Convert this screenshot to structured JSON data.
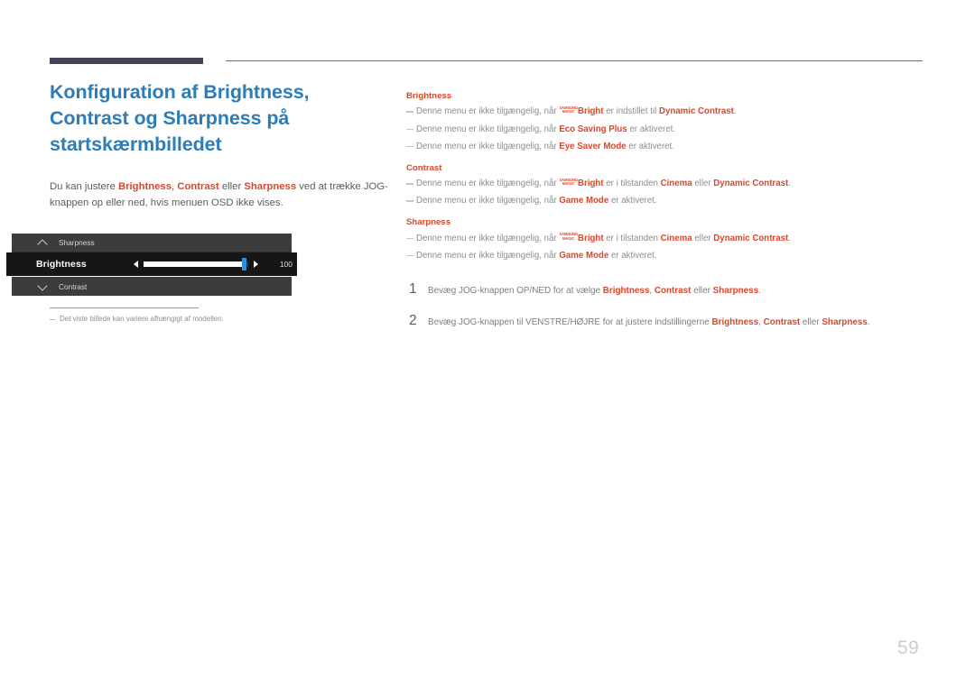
{
  "page": {
    "number": "59",
    "title": "Konfiguration af Brightness, Contrast og Sharpness på startskærmbilledet",
    "intro": {
      "t1": "Du kan justere ",
      "k1": "Brightness",
      "t2": ", ",
      "k2": "Contrast",
      "t3": " eller ",
      "k3": "Sharpness",
      "t4": " ved at trække JOG-knappen op eller ned, hvis menuen OSD ikke vises."
    },
    "figure_note": "Det viste billede kan variere afhængigt af modellen."
  },
  "colors": {
    "title_blue": "#2c7cb5",
    "accent_orange": "#d9472b",
    "body_gray": "#8d8d8f",
    "rule_dark": "#474354",
    "osd_row_bg": "#3c3c3c",
    "osd_selected_bg": "#161616",
    "slider_knob": "#2e8ce0",
    "page_number": "#c9ccd6"
  },
  "osd": {
    "rows": [
      {
        "icon": "chevron-up-icon",
        "label": "Sharpness"
      },
      {
        "icon": "chevron-down-icon",
        "label": "Contrast"
      }
    ],
    "selected": {
      "label": "Brightness",
      "value": "100",
      "left_arrow": "◀",
      "right_arrow": "▶",
      "slider_percent": 96
    }
  },
  "right": {
    "sections": [
      {
        "heading": "Brightness",
        "notes": [
          {
            "parts": [
              {
                "type": "plain",
                "text": "Denne menu er ikke tilgængelig, når "
              },
              {
                "type": "magic"
              },
              {
                "type": "bold",
                "text": "Bright"
              },
              {
                "type": "plain",
                "text": " er indstillet til "
              },
              {
                "type": "bold",
                "text": "Dynamic Contrast"
              },
              {
                "type": "plain",
                "text": "."
              }
            ]
          },
          {
            "parts": [
              {
                "type": "plain",
                "text": "Denne menu er ikke tilgængelig, når "
              },
              {
                "type": "bold",
                "text": "Eco Saving Plus"
              },
              {
                "type": "plain",
                "text": " er aktiveret."
              }
            ]
          },
          {
            "parts": [
              {
                "type": "plain",
                "text": "Denne menu er ikke tilgængelig, når "
              },
              {
                "type": "bold",
                "text": "Eye Saver Mode"
              },
              {
                "type": "plain",
                "text": " er aktiveret."
              }
            ]
          }
        ]
      },
      {
        "heading": "Contrast",
        "notes": [
          {
            "parts": [
              {
                "type": "plain",
                "text": "Denne menu er ikke tilgængelig, når "
              },
              {
                "type": "magic"
              },
              {
                "type": "bold",
                "text": "Bright"
              },
              {
                "type": "plain",
                "text": " er i tilstanden "
              },
              {
                "type": "bold",
                "text": "Cinema"
              },
              {
                "type": "plain",
                "text": " eller "
              },
              {
                "type": "bold",
                "text": "Dynamic Contrast"
              },
              {
                "type": "plain",
                "text": "."
              }
            ]
          },
          {
            "parts": [
              {
                "type": "plain",
                "text": "Denne menu er ikke tilgængelig, når "
              },
              {
                "type": "bold",
                "text": "Game Mode"
              },
              {
                "type": "plain",
                "text": " er aktiveret."
              }
            ]
          }
        ]
      },
      {
        "heading": "Sharpness",
        "notes": [
          {
            "parts": [
              {
                "type": "plain",
                "text": "Denne menu er ikke tilgængelig, når "
              },
              {
                "type": "magic"
              },
              {
                "type": "bold",
                "text": "Bright"
              },
              {
                "type": "plain",
                "text": " er i tilstanden "
              },
              {
                "type": "bold",
                "text": "Cinema"
              },
              {
                "type": "plain",
                "text": " eller "
              },
              {
                "type": "bold",
                "text": "Dynamic Contrast"
              },
              {
                "type": "plain",
                "text": "."
              }
            ]
          },
          {
            "parts": [
              {
                "type": "plain",
                "text": "Denne menu er ikke tilgængelig, når "
              },
              {
                "type": "bold",
                "text": "Game Mode"
              },
              {
                "type": "plain",
                "text": " er aktiveret."
              }
            ]
          }
        ]
      }
    ],
    "magic_logo": {
      "line1": "SAMSUNG",
      "line2": "MAGIC"
    },
    "steps": [
      {
        "num": "1",
        "parts": [
          {
            "type": "plain",
            "text": "Bevæg JOG-knappen OP/NED for at vælge "
          },
          {
            "type": "bold",
            "text": "Brightness"
          },
          {
            "type": "plain",
            "text": ", "
          },
          {
            "type": "bold",
            "text": "Contrast"
          },
          {
            "type": "plain",
            "text": " eller "
          },
          {
            "type": "bold",
            "text": "Sharpness"
          },
          {
            "type": "plain",
            "text": "."
          }
        ]
      },
      {
        "num": "2",
        "parts": [
          {
            "type": "plain",
            "text": "Bevæg JOG-knappen til VENSTRE/HØJRE for at justere indstillingerne "
          },
          {
            "type": "bold",
            "text": "Brightness"
          },
          {
            "type": "plain",
            "text": ", "
          },
          {
            "type": "bold",
            "text": "Contrast"
          },
          {
            "type": "plain",
            "text": " eller "
          },
          {
            "type": "bold",
            "text": "Sharpness"
          },
          {
            "type": "plain",
            "text": "."
          }
        ]
      }
    ]
  }
}
